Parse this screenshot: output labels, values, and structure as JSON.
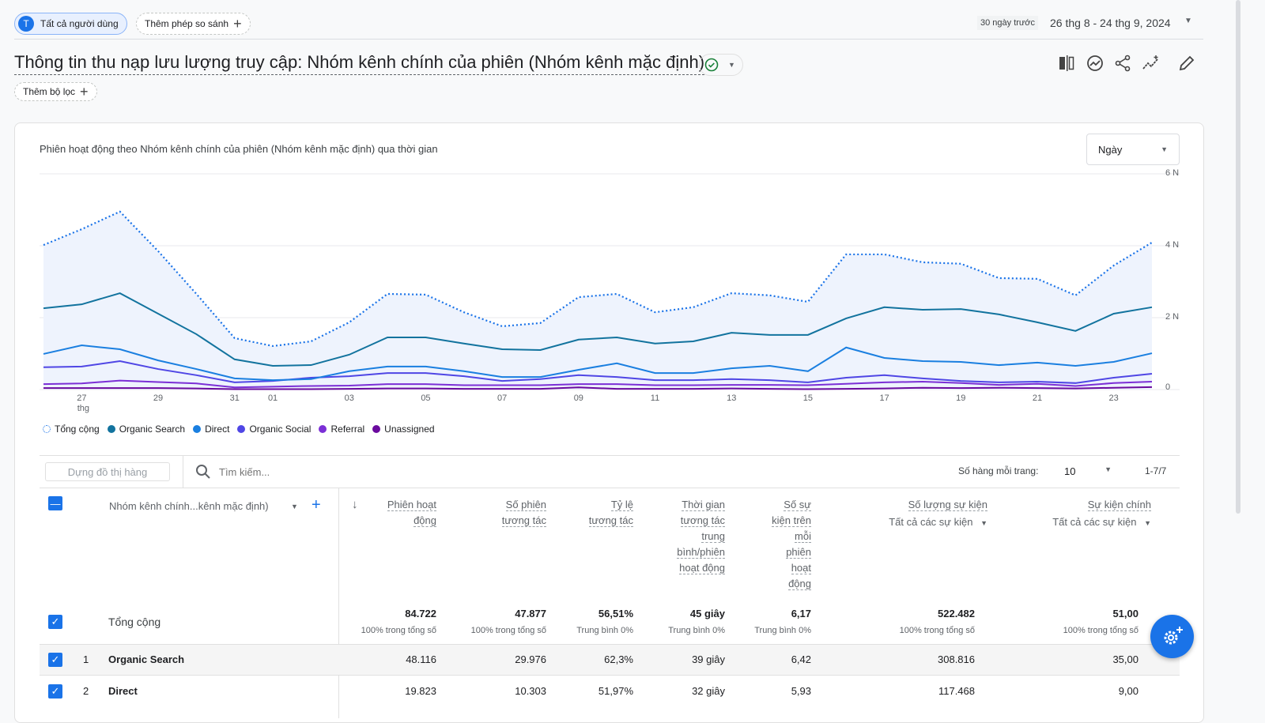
{
  "header": {
    "segment_initial": "T",
    "segment": "Tất cả người dùng",
    "add_comparison": "Thêm phép so sánh",
    "date_preset": "30 ngày trước",
    "date_range": "26 thg 8 - 24 thg 9, 2024"
  },
  "title": "Thông tin thu nạp lưu lượng truy cập: Nhóm kênh chính của phiên (Nhóm kênh mặc định)",
  "add_filter": "Thêm bộ lọc",
  "chart_card": {
    "title": "Phiên hoạt động theo Nhóm kênh chính của phiên (Nhóm kênh mặc định) qua thời gian",
    "granularity": "Ngày"
  },
  "chart_data": {
    "type": "line",
    "x_tick_labels": [
      "27",
      "thg",
      "29",
      "31",
      "01",
      "03",
      "05",
      "07",
      "09",
      "11",
      "13",
      "15",
      "17",
      "19",
      "21",
      "23"
    ],
    "x": [
      "2024-08-26",
      "2024-08-27",
      "2024-08-28",
      "2024-08-29",
      "2024-08-30",
      "2024-08-31",
      "2024-09-01",
      "2024-09-02",
      "2024-09-03",
      "2024-09-04",
      "2024-09-05",
      "2024-09-06",
      "2024-09-07",
      "2024-09-08",
      "2024-09-09",
      "2024-09-10",
      "2024-09-11",
      "2024-09-12",
      "2024-09-13",
      "2024-09-14",
      "2024-09-15",
      "2024-09-16",
      "2024-09-17",
      "2024-09-18",
      "2024-09-19",
      "2024-09-20",
      "2024-09-21",
      "2024-09-22",
      "2024-09-23",
      "2024-09-24"
    ],
    "y_ticks": [
      "0",
      "2 N",
      "4 N",
      "6 N"
    ],
    "ylim": [
      0,
      6000
    ],
    "grid": true,
    "legend": "bottom-left",
    "series": [
      {
        "name": "Tổng cộng",
        "color": "#1a73e8",
        "dashed": true,
        "values": [
          4020,
          4460,
          4950,
          3850,
          2660,
          1430,
          1210,
          1340,
          1870,
          2660,
          2640,
          2150,
          1760,
          1850,
          2570,
          2660,
          2150,
          2290,
          2680,
          2620,
          2440,
          3760,
          3760,
          3540,
          3500,
          3100,
          3080,
          2620,
          3450,
          4090
        ]
      },
      {
        "name": "Organic Search",
        "color": "#12739e",
        "values": [
          2260,
          2370,
          2680,
          2110,
          1540,
          840,
          660,
          680,
          970,
          1450,
          1450,
          1280,
          1120,
          1100,
          1390,
          1450,
          1280,
          1340,
          1580,
          1520,
          1520,
          1980,
          2290,
          2220,
          2240,
          2090,
          1870,
          1630,
          2110,
          2290
        ]
      },
      {
        "name": "Direct",
        "color": "#1a7fe0",
        "values": [
          990,
          1230,
          1120,
          810,
          570,
          310,
          260,
          290,
          510,
          640,
          640,
          510,
          350,
          350,
          550,
          730,
          460,
          460,
          590,
          660,
          510,
          1170,
          880,
          790,
          770,
          680,
          750,
          660,
          770,
          1010
        ]
      },
      {
        "name": "Organic Social",
        "color": "#4f46e5",
        "values": [
          620,
          640,
          790,
          570,
          400,
          200,
          240,
          330,
          370,
          460,
          460,
          370,
          240,
          290,
          400,
          350,
          260,
          260,
          290,
          260,
          200,
          330,
          400,
          310,
          240,
          200,
          220,
          180,
          330,
          440
        ]
      },
      {
        "name": "Referral",
        "color": "#7b2fd6",
        "values": [
          150,
          170,
          250,
          210,
          170,
          60,
          80,
          100,
          110,
          150,
          150,
          120,
          120,
          120,
          150,
          150,
          120,
          120,
          130,
          130,
          120,
          160,
          200,
          220,
          180,
          130,
          160,
          100,
          180,
          220
        ]
      },
      {
        "name": "Unassigned",
        "color": "#6a0a9e",
        "values": [
          40,
          40,
          40,
          40,
          30,
          10,
          10,
          10,
          20,
          30,
          30,
          20,
          20,
          20,
          60,
          20,
          20,
          20,
          30,
          20,
          10,
          20,
          30,
          50,
          40,
          50,
          40,
          30,
          50,
          70
        ]
      }
    ]
  },
  "toolbar": {
    "build_row_chart": "Dựng đồ thị hàng",
    "search_placeholder": "Tìm kiếm...",
    "rows_per_page_label": "Số hàng mỗi trang:",
    "rows_per_page": "10",
    "pagination": "1-7/7"
  },
  "table": {
    "dimension_header": "Nhóm kênh chính...kênh mặc định)",
    "columns": [
      {
        "label": [
          "Phiên hoạt",
          "động"
        ]
      },
      {
        "label": [
          "Số phiên",
          "tương tác"
        ]
      },
      {
        "label": [
          "Tỷ lệ",
          "tương tác"
        ]
      },
      {
        "label": [
          "Thời gian",
          "tương tác",
          "trung",
          "bình/phiên",
          "hoạt động"
        ]
      },
      {
        "label": [
          "Số sự",
          "kiện trên",
          "mỗi",
          "phiên",
          "hoạt",
          "động"
        ]
      },
      {
        "label": [
          "Số lượng sự kiện"
        ],
        "filter": "Tất cả các sự kiện"
      },
      {
        "label": [
          "Sự kiện chính"
        ],
        "filter": "Tất cả các sự kiện"
      }
    ],
    "total": {
      "label": "Tổng cộng",
      "values": [
        "84.722",
        "47.877",
        "56,51%",
        "45 giây",
        "6,17",
        "522.482",
        "51,00"
      ],
      "subs": [
        "100% trong tổng số",
        "100% trong tổng số",
        "Trung bình 0%",
        "Trung bình 0%",
        "Trung bình 0%",
        "100% trong tổng số",
        "100% trong tổng số"
      ]
    },
    "rows": [
      {
        "rank": "1",
        "name": "Organic Search",
        "values": [
          "48.116",
          "29.976",
          "62,3%",
          "39 giây",
          "6,42",
          "308.816",
          "35,00"
        ]
      },
      {
        "rank": "2",
        "name": "Direct",
        "values": [
          "19.823",
          "10.303",
          "51,97%",
          "32 giây",
          "5,93",
          "117.468",
          "9,00"
        ]
      }
    ]
  }
}
